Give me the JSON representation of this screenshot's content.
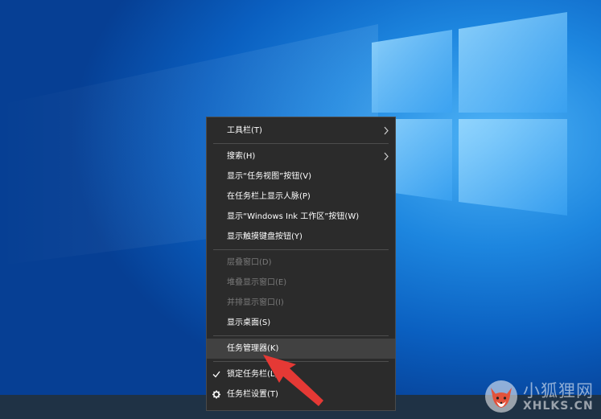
{
  "context_menu": {
    "items": [
      {
        "label": "工具栏(T)",
        "submenu": true
      },
      {
        "label": "搜索(H)",
        "submenu": true
      },
      {
        "label": "显示“任务视图”按钮(V)"
      },
      {
        "label": "在任务栏上显示人脉(P)"
      },
      {
        "label": "显示“Windows Ink 工作区”按钮(W)"
      },
      {
        "label": "显示触摸键盘按钮(Y)"
      },
      {
        "label": "层叠窗口(D)",
        "disabled": true
      },
      {
        "label": "堆叠显示窗口(E)",
        "disabled": true
      },
      {
        "label": "并排显示窗口(I)",
        "disabled": true
      },
      {
        "label": "显示桌面(S)"
      },
      {
        "label": "任务管理器(K)",
        "highlighted": true
      },
      {
        "label": "锁定任务栏(L)",
        "checked": true
      },
      {
        "label": "任务栏设置(T)",
        "icon": "gear-icon"
      }
    ]
  },
  "watermark": {
    "name": "小狐狸网",
    "domain": "XHLKS.CN"
  },
  "colors": {
    "menu_bg": "#2b2b2b",
    "arrow": "#e53935"
  }
}
